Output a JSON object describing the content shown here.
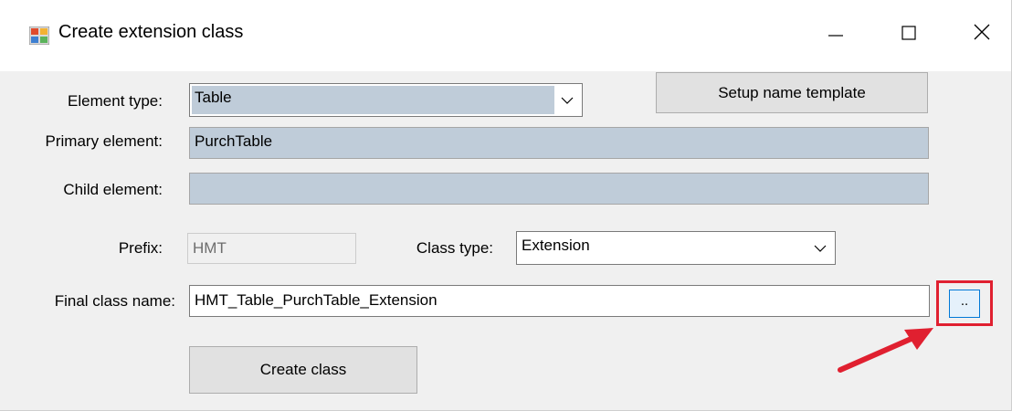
{
  "window": {
    "title": "Create extension class",
    "icon": "form-app-icon",
    "controls": [
      "minimize-icon",
      "maximize-icon",
      "close-icon"
    ]
  },
  "form": {
    "element_type_label": "Element type:",
    "element_type_value": "Table",
    "setup_template_label": "Setup name template",
    "primary_element_label": "Primary element:",
    "primary_element_value": "PurchTable",
    "child_element_label": "Child element:",
    "child_element_value": "",
    "prefix_label": "Prefix:",
    "prefix_value": "HMT",
    "class_type_label": "Class type:",
    "class_type_value": "Extension",
    "final_class_label": "Final class name:",
    "final_class_value": "HMT_Table_PurchTable_Extension",
    "browse_label": "..",
    "create_label": "Create class"
  },
  "annotation": {
    "color": "#e02030"
  }
}
